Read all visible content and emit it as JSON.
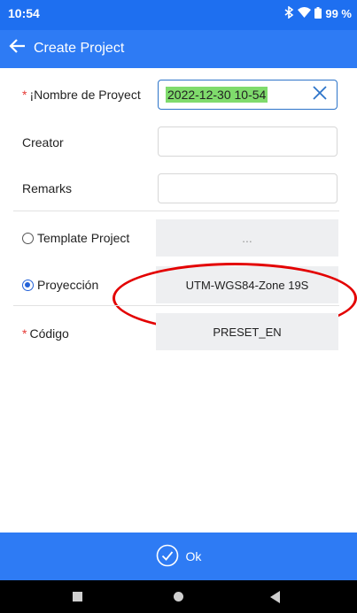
{
  "status": {
    "time": "10:54",
    "battery": "99 %",
    "icons": [
      "bluetooth-icon",
      "wifi-icon",
      "battery-icon"
    ]
  },
  "appbar": {
    "title": "Create Project",
    "back_icon": "arrow-left-icon"
  },
  "form": {
    "project_name": {
      "label": "¡Nombre de Proyect",
      "value": "2022-12-30 10-54",
      "required": true
    },
    "creator": {
      "label": "Creator",
      "value": ""
    },
    "remarks": {
      "label": "Remarks",
      "value": ""
    },
    "template": {
      "label": "Template Project",
      "value": "...",
      "selected": false
    },
    "projection": {
      "label": "Proyección",
      "value": "UTM-WGS84-Zone 19S",
      "selected": true
    },
    "code": {
      "label": "Código",
      "value": "PRESET_EN",
      "required": true
    }
  },
  "footer": {
    "ok_label": "Ok"
  },
  "colors": {
    "primary": "#2e7bf4",
    "status_bar": "#1e6ff0",
    "highlight": "#7fdb6c",
    "annotation": "#e30000"
  }
}
